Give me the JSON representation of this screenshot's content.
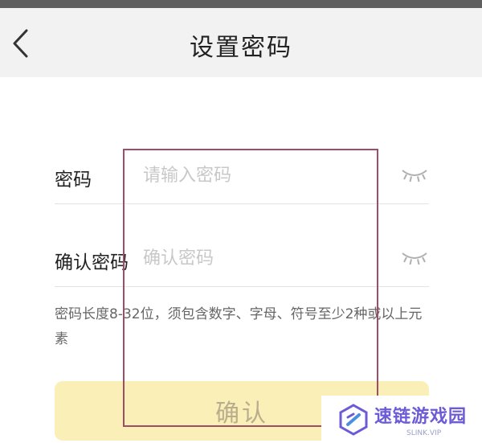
{
  "header": {
    "title": "设置密码"
  },
  "form": {
    "password": {
      "label": "密码",
      "placeholder": "请输入密码",
      "value": ""
    },
    "confirm": {
      "label": "确认密码",
      "placeholder": "确认密码",
      "value": ""
    }
  },
  "hint": {
    "text": "密码长度8-32位，须包含数字、字母、符号至少2种或以上元素"
  },
  "submit": {
    "label": "确认"
  },
  "watermark": {
    "name": "速链游戏园",
    "url": "SLINK.VIP"
  },
  "colors": {
    "nav_background": "#f2f2f2",
    "button_background": "#fbefb8",
    "button_text": "#b8ad8d",
    "highlight_border": "#9d4d64",
    "watermark_accent": "#6b5bd6"
  },
  "icons": {
    "back": "chevron-left-icon",
    "password_toggle": "eye-closed-icon",
    "watermark_logo": "hexagon-logo-icon"
  }
}
